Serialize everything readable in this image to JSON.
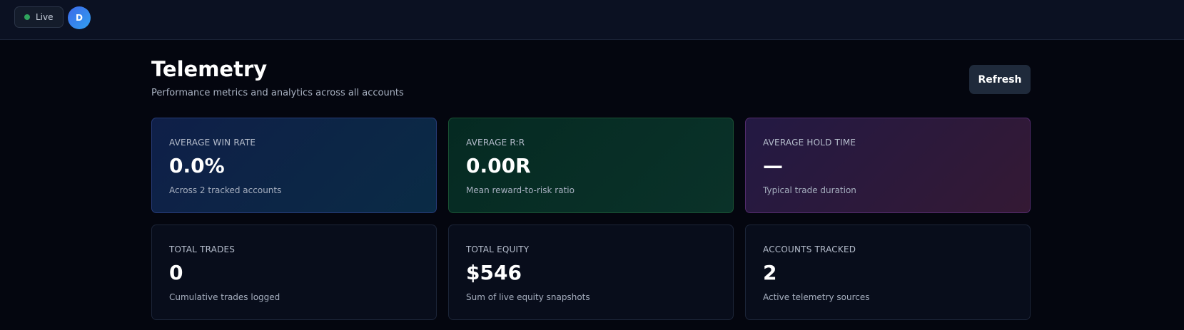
{
  "header": {
    "status_label": "Live",
    "status_color": "#2fa45d",
    "avatar_initial": "D"
  },
  "page": {
    "title": "Telemetry",
    "subtitle": "Performance metrics and analytics across all accounts",
    "refresh_label": "Refresh"
  },
  "cards": [
    {
      "label": "AVERAGE WIN RATE",
      "value": "0.0%",
      "description": "Across 2 tracked accounts",
      "accent": "#273b77"
    },
    {
      "label": "AVERAGE R:R",
      "value": "0.00R",
      "description": "Mean reward-to-risk ratio",
      "accent": "#1a5234"
    },
    {
      "label": "AVERAGE HOLD TIME",
      "value": "—",
      "description": "Typical trade duration",
      "accent": "#532b6d"
    },
    {
      "label": "TOTAL TRADES",
      "value": "0",
      "description": "Cumulative trades logged"
    },
    {
      "label": "TOTAL EQUITY",
      "value": "$546",
      "description": "Sum of live equity snapshots"
    },
    {
      "label": "ACCOUNTS TRACKED",
      "value": "2",
      "description": "Active telemetry sources"
    }
  ]
}
